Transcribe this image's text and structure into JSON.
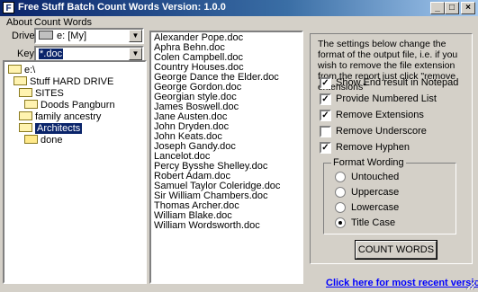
{
  "window": {
    "title": "Free Stuff Batch Count Words Version: 1.0.0",
    "icon_letter": "F",
    "controls": {
      "minimize": "_",
      "maximize": "□",
      "close": "×"
    }
  },
  "menu": [
    "About",
    "Count Words"
  ],
  "drive": {
    "label": "Drive:",
    "value": "e: [My]"
  },
  "key": {
    "label": "Key:",
    "value": "*.doc"
  },
  "tree": [
    {
      "label": "e:\\"
    },
    {
      "label": "Stuff HARD DRIVE"
    },
    {
      "label": "SITES"
    },
    {
      "label": "Doods Pangburn"
    },
    {
      "label": "family ancestry"
    },
    {
      "label": "Architects"
    },
    {
      "label": "done"
    }
  ],
  "files": [
    "Alexander Pope.doc",
    "Aphra Behn.doc",
    "Colen Campbell.doc",
    "Country Houses.doc",
    "George Dance the Elder.doc",
    "George Gordon.doc",
    "Georgian style.doc",
    "James Boswell.doc",
    "Jane Austen.doc",
    "John Dryden.doc",
    "John Keats.doc",
    "Joseph Gandy.doc",
    "Lancelot.doc",
    "Percy Bysshe Shelley.doc",
    "Robert Adam.doc",
    "Samuel Taylor Coleridge.doc",
    "Sir William Chambers.doc",
    "Thomas Archer.doc",
    "William Blake.doc",
    "William Wordsworth.doc"
  ],
  "options": {
    "description": "The settings below change the format of the output file, i.e. if you wish to remove the file extension from the report just click \"remove extensions\"",
    "checkboxes": [
      {
        "label": "Show End result in Notepad",
        "checked": true
      },
      {
        "label": "Provide Numbered List",
        "checked": true
      },
      {
        "label": "Remove Extensions",
        "checked": true
      },
      {
        "label": "Remove Underscore",
        "checked": false
      },
      {
        "label": "Remove Hyphen",
        "checked": true
      }
    ],
    "format_title": "Format Wording",
    "radios": [
      {
        "label": "Untouched",
        "selected": false
      },
      {
        "label": "Uppercase",
        "selected": false
      },
      {
        "label": "Lowercase",
        "selected": false
      },
      {
        "label": "Title Case",
        "selected": true
      }
    ],
    "button": "COUNT WORDS"
  },
  "link": "Click here for most recent version.",
  "colors": {
    "titlebar": "#0a246a",
    "selection": "#0a246a",
    "link": "#0000ff",
    "face": "#d4d0c8"
  }
}
